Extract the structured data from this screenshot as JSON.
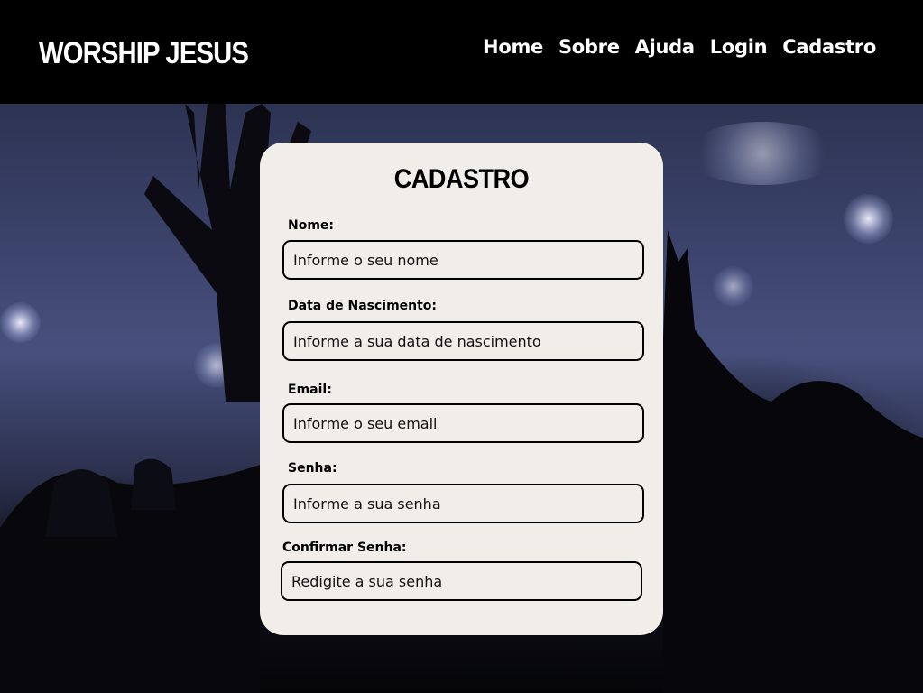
{
  "header": {
    "brand": "WORSHIP JESUS",
    "nav": [
      "Home",
      "Sobre",
      "Ajuda",
      "Login",
      "Cadastro"
    ]
  },
  "form": {
    "title": "CADASTRO",
    "fields": [
      {
        "label": "Nome:",
        "placeholder": "Informe o seu nome"
      },
      {
        "label": "Data de Nascimento:",
        "placeholder": "Informe a sua data de nascimento"
      },
      {
        "label": "Email:",
        "placeholder": "Informe o seu email"
      },
      {
        "label": "Senha:",
        "placeholder": "Informe a sua senha"
      },
      {
        "label": "Confirmar Senha:",
        "placeholder": "Redigite a sua senha"
      }
    ]
  }
}
